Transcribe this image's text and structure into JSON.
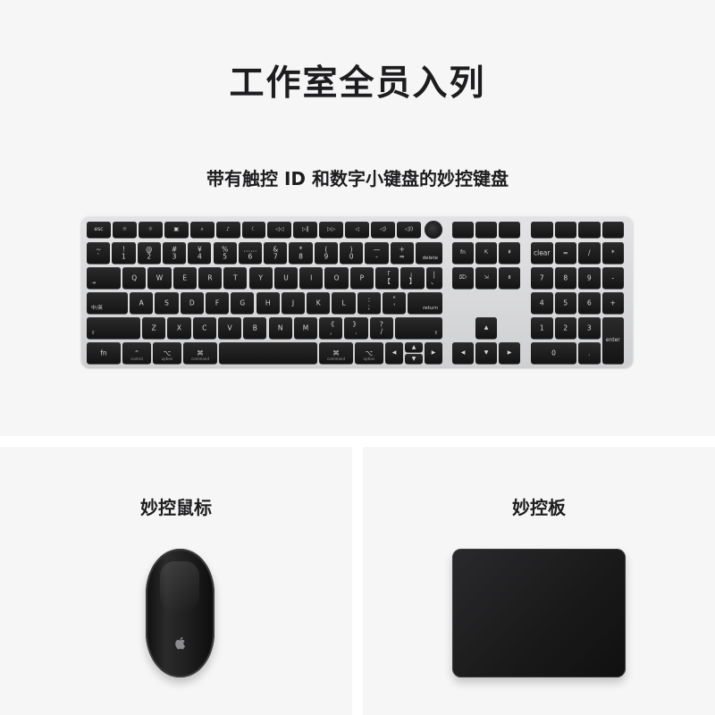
{
  "header": {
    "title": "工作室全员入列",
    "subtitle": "带有触控 ID 和数字小键盘的妙控键盘"
  },
  "products": {
    "mouse_label": "妙控鼠标",
    "trackpad_label": "妙控板"
  },
  "colors": {
    "panel_bg": "#f6f6f6",
    "keyboard_body": "#d6d7d9",
    "key_black": "#1c1c1d",
    "key_text": "#d8d8d8",
    "device_black": "#1b1b1c"
  },
  "icons": {
    "mouse_logo": "apple-logo-icon",
    "touch_id": "touch-id-icon"
  },
  "keyboard": {
    "fn_row": [
      "esc",
      "☼",
      "☼",
      "▣",
      "⌕",
      "♪",
      "☾",
      "◁◁",
      "▷‖",
      "▷▷",
      "◁",
      "◁)",
      "◁))"
    ],
    "num_row": [
      "~\n`",
      "!\n1",
      "@\n2",
      "#\n3",
      "¥\n4",
      "%\n5",
      "……\n6",
      "&\n7",
      "*\n8",
      "(\n9",
      ")\n0",
      "—\n-",
      "+\n=",
      "delete"
    ],
    "qwerty_row": [
      "⇥",
      "Q",
      "W",
      "E",
      "R",
      "T",
      "Y",
      "U",
      "I",
      "O",
      "P",
      "「\n【",
      "」\n】",
      "|\n、"
    ],
    "home_row": [
      "中/英",
      "A",
      "S",
      "D",
      "F",
      "G",
      "H",
      "J",
      "K",
      "L",
      ":\n;",
      "\"\n'",
      "return"
    ],
    "shift_row": [
      "⇧",
      "Z",
      "X",
      "C",
      "V",
      "B",
      "N",
      "M",
      "《\n,",
      "》\n.",
      "?\n/",
      "⇧"
    ],
    "bottom_row": [
      "fn",
      "⌃",
      "⌥",
      "⌘",
      "",
      "⌘",
      "⌥",
      "◀"
    ],
    "bottom_sub": [
      "",
      "control",
      "option",
      "command",
      "",
      "command",
      "option",
      ""
    ],
    "nav_block": [
      "fn",
      "⇱",
      "⇞",
      "⌦",
      "⇲",
      "⇟"
    ],
    "arrows": [
      "▲",
      "◀",
      "▼",
      "▶"
    ],
    "numpad": [
      [
        "clear",
        "=",
        "/",
        "*"
      ],
      [
        "7",
        "8",
        "9",
        "-"
      ],
      [
        "4",
        "5",
        "6",
        "+"
      ],
      [
        "1",
        "2",
        "3",
        ""
      ],
      [
        "0",
        ".",
        ""
      ]
    ],
    "numpad_enter": "enter"
  }
}
